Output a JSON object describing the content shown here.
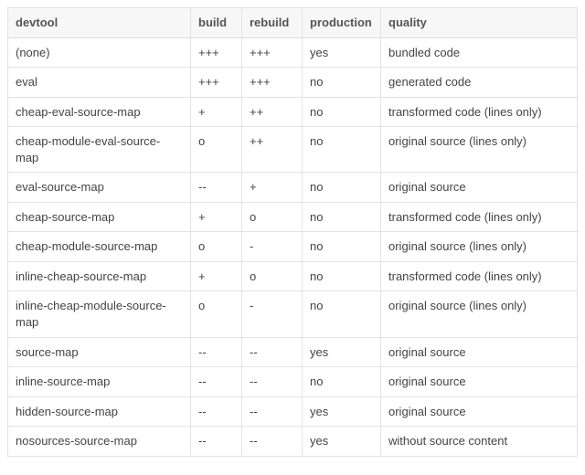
{
  "table": {
    "headers": {
      "devtool": "devtool",
      "build": "build",
      "rebuild": "rebuild",
      "production": "production",
      "quality": "quality"
    },
    "rows": [
      {
        "devtool": "(none)",
        "build": "+++",
        "rebuild": "+++",
        "production": "yes",
        "quality": "bundled code"
      },
      {
        "devtool": "eval",
        "build": "+++",
        "rebuild": "+++",
        "production": "no",
        "quality": "generated code"
      },
      {
        "devtool": "cheap-eval-source-map",
        "build": "+",
        "rebuild": "++",
        "production": "no",
        "quality": "transformed code (lines only)"
      },
      {
        "devtool": "cheap-module-eval-source-map",
        "build": "o",
        "rebuild": "++",
        "production": "no",
        "quality": "original source (lines only)"
      },
      {
        "devtool": "eval-source-map",
        "build": "--",
        "rebuild": "+",
        "production": "no",
        "quality": "original source"
      },
      {
        "devtool": "cheap-source-map",
        "build": "+",
        "rebuild": "o",
        "production": "no",
        "quality": "transformed code (lines only)"
      },
      {
        "devtool": "cheap-module-source-map",
        "build": "o",
        "rebuild": "-",
        "production": "no",
        "quality": "original source (lines only)"
      },
      {
        "devtool": "inline-cheap-source-map",
        "build": "+",
        "rebuild": "o",
        "production": "no",
        "quality": "transformed code (lines only)"
      },
      {
        "devtool": "inline-cheap-module-source-map",
        "build": "o",
        "rebuild": "-",
        "production": "no",
        "quality": "original source (lines only)"
      },
      {
        "devtool": "source-map",
        "build": "--",
        "rebuild": "--",
        "production": "yes",
        "quality": "original source"
      },
      {
        "devtool": "inline-source-map",
        "build": "--",
        "rebuild": "--",
        "production": "no",
        "quality": "original source"
      },
      {
        "devtool": "hidden-source-map",
        "build": "--",
        "rebuild": "--",
        "production": "yes",
        "quality": "original source"
      },
      {
        "devtool": "nosources-source-map",
        "build": "--",
        "rebuild": "--",
        "production": "yes",
        "quality": "without source content"
      }
    ]
  },
  "chart_data": {
    "type": "table",
    "title": "",
    "columns": [
      "devtool",
      "build",
      "rebuild",
      "production",
      "quality"
    ],
    "rows": [
      [
        "(none)",
        "+++",
        "+++",
        "yes",
        "bundled code"
      ],
      [
        "eval",
        "+++",
        "+++",
        "no",
        "generated code"
      ],
      [
        "cheap-eval-source-map",
        "+",
        "++",
        "no",
        "transformed code (lines only)"
      ],
      [
        "cheap-module-eval-source-map",
        "o",
        "++",
        "no",
        "original source (lines only)"
      ],
      [
        "eval-source-map",
        "--",
        "+",
        "no",
        "original source"
      ],
      [
        "cheap-source-map",
        "+",
        "o",
        "no",
        "transformed code (lines only)"
      ],
      [
        "cheap-module-source-map",
        "o",
        "-",
        "no",
        "original source (lines only)"
      ],
      [
        "inline-cheap-source-map",
        "+",
        "o",
        "no",
        "transformed code (lines only)"
      ],
      [
        "inline-cheap-module-source-map",
        "o",
        "-",
        "no",
        "original source (lines only)"
      ],
      [
        "source-map",
        "--",
        "--",
        "yes",
        "original source"
      ],
      [
        "inline-source-map",
        "--",
        "--",
        "no",
        "original source"
      ],
      [
        "hidden-source-map",
        "--",
        "--",
        "yes",
        "original source"
      ],
      [
        "nosources-source-map",
        "--",
        "--",
        "yes",
        "without source content"
      ]
    ]
  }
}
